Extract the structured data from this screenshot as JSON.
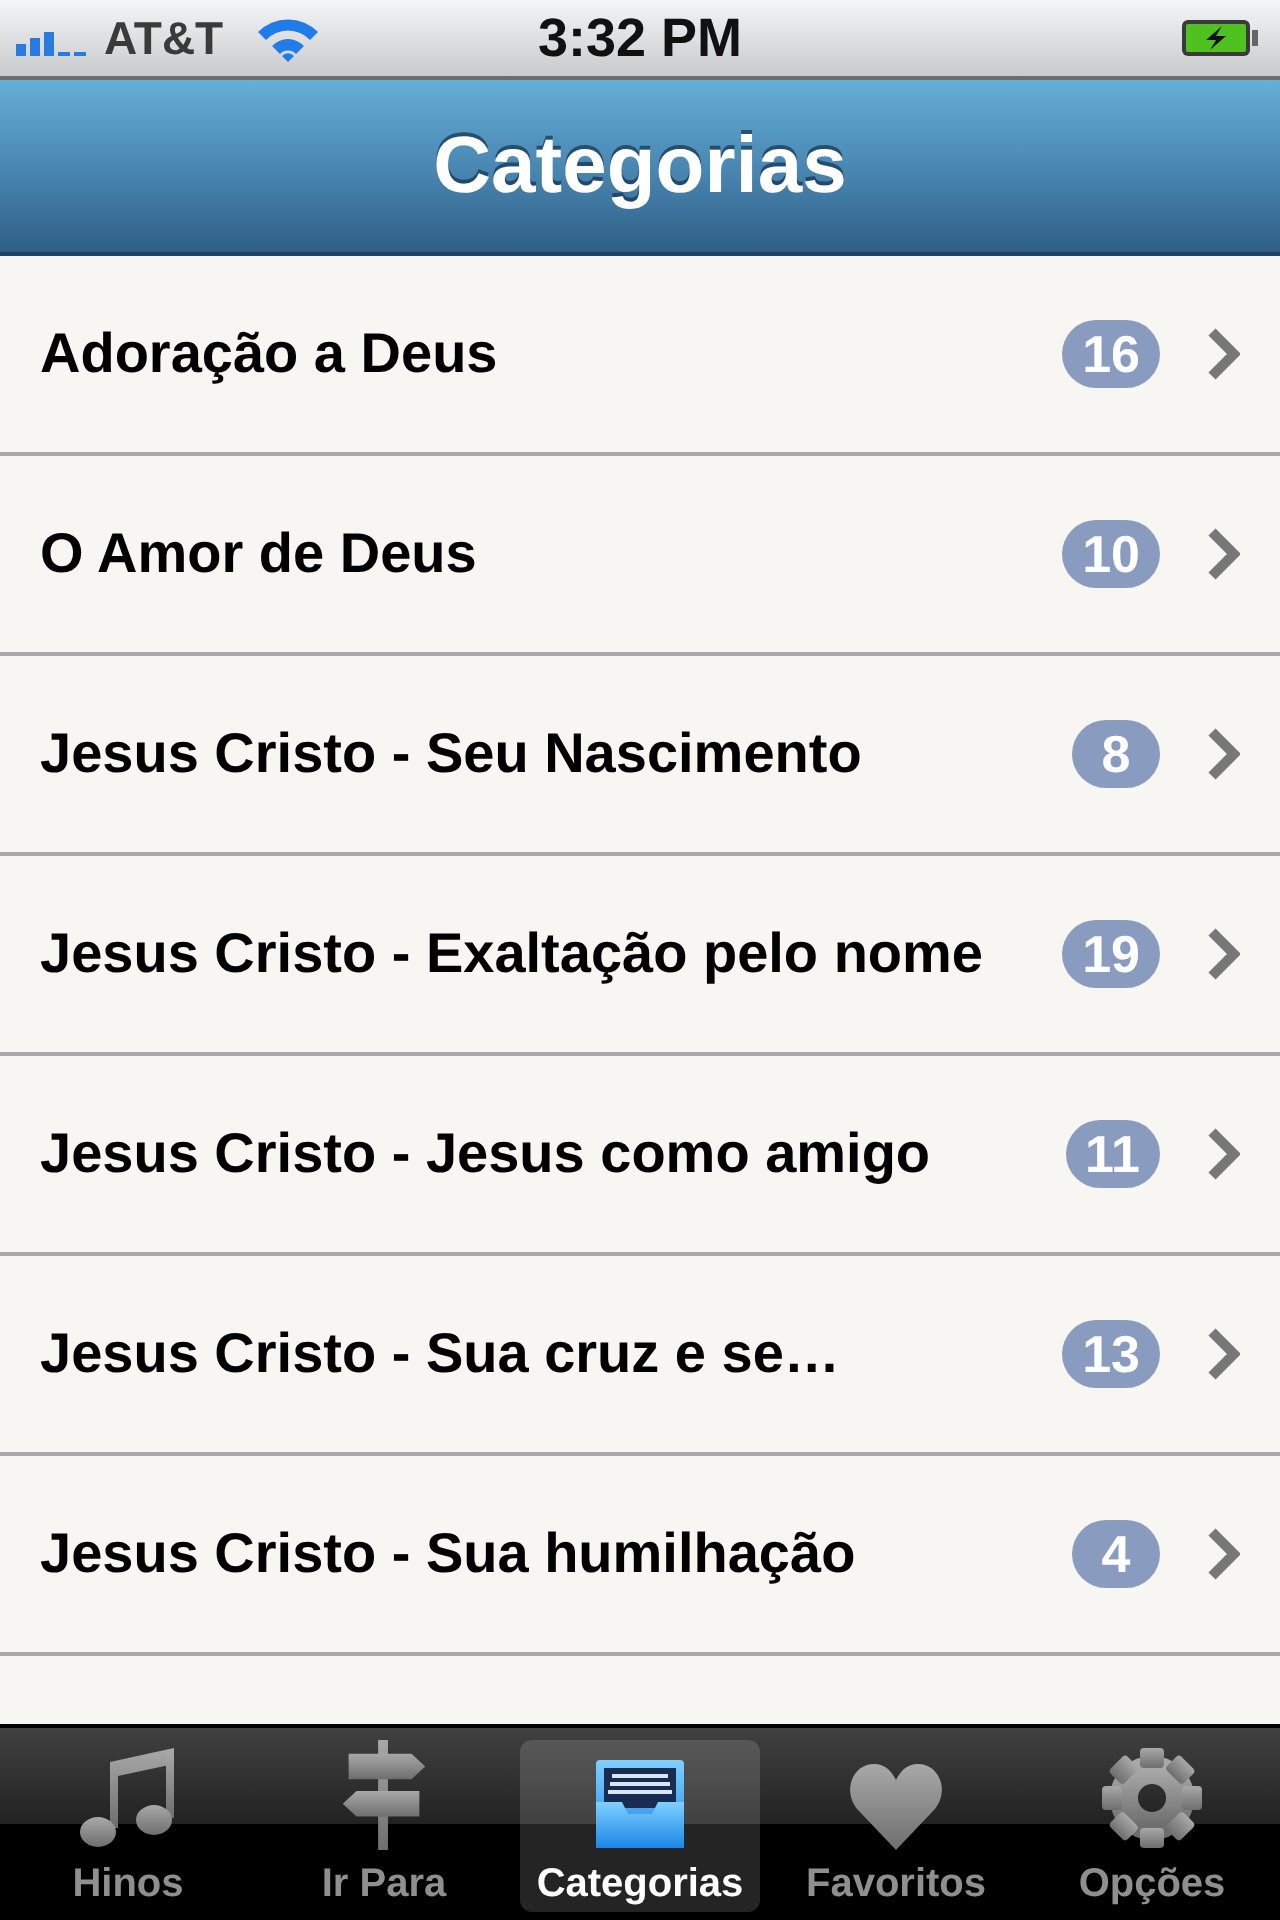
{
  "status_bar": {
    "carrier": "AT&T",
    "time": "3:32 PM"
  },
  "nav_bar": {
    "title": "Categorias"
  },
  "categories": [
    {
      "name": "Adoração a Deus",
      "count": "16"
    },
    {
      "name": "O Amor de Deus",
      "count": "10"
    },
    {
      "name": "Jesus Cristo - Seu Nascimento",
      "count": "8"
    },
    {
      "name": "Jesus Cristo - Exaltação pelo nome",
      "count": "19"
    },
    {
      "name": "Jesus Cristo - Jesus como amigo",
      "count": "11"
    },
    {
      "name": "Jesus Cristo - Sua cruz e se…",
      "count": "13"
    },
    {
      "name": "Jesus Cristo - Sua humilhação",
      "count": "4"
    }
  ],
  "tab_bar": [
    {
      "label": "Hinos",
      "kind": "music",
      "selected": false
    },
    {
      "label": "Ir Para",
      "kind": "signpost",
      "selected": false
    },
    {
      "label": "Categorias",
      "kind": "tray",
      "selected": true
    },
    {
      "label": "Favoritos",
      "kind": "heart",
      "selected": false
    },
    {
      "label": "Opções",
      "kind": "gear",
      "selected": false
    }
  ]
}
